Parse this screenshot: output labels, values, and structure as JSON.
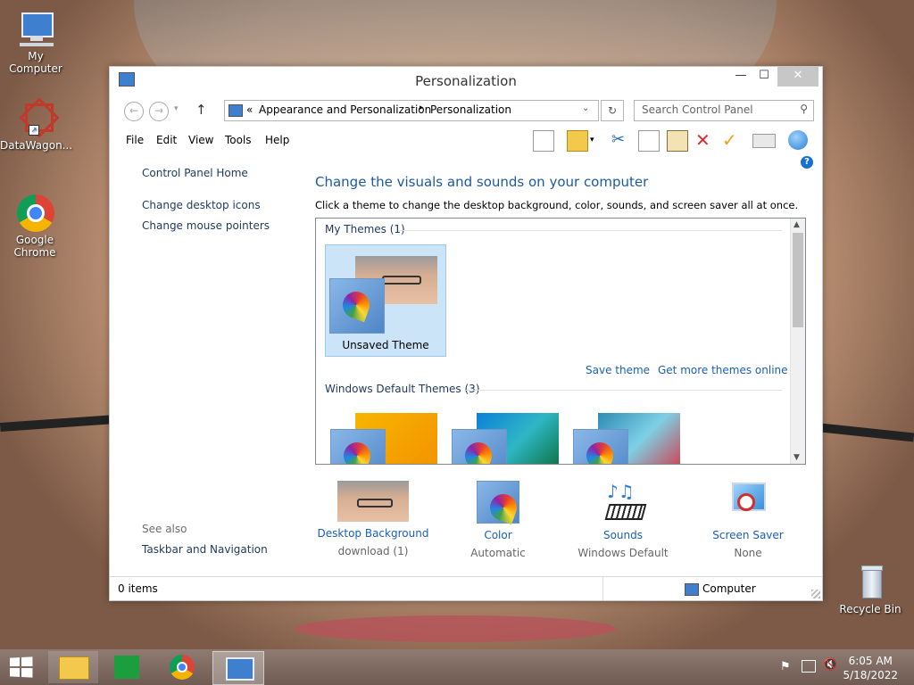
{
  "desktop": {
    "icons": [
      {
        "label": "My Computer"
      },
      {
        "label": "DataWagon..."
      },
      {
        "label": "Google Chrome"
      },
      {
        "label": "Recycle Bin"
      }
    ]
  },
  "window": {
    "title": "Personalization",
    "controls": {
      "minimize": "—",
      "maximize": "☐",
      "close": "✕"
    },
    "address": {
      "chevrons": "«",
      "crumb1": "Appearance and Personalization",
      "separator": "▸",
      "crumb2": "Personalization"
    },
    "search": {
      "placeholder": "Search Control Panel"
    },
    "menu": [
      "File",
      "Edit",
      "View",
      "Tools",
      "Help"
    ],
    "left": {
      "home": "Control Panel Home",
      "links": [
        "Change desktop icons",
        "Change mouse pointers"
      ],
      "see_also": "See also",
      "see_also_link": "Taskbar and Navigation"
    },
    "main": {
      "heading": "Change the visuals and sounds on your computer",
      "subtext": "Click a theme to change the desktop background, color, sounds, and screen saver all at once.",
      "my_themes_header": "My Themes (1)",
      "unsaved_theme": "Unsaved Theme",
      "save_theme": "Save theme",
      "get_more": "Get more themes online",
      "default_themes_header": "Windows Default Themes (3)"
    },
    "bottom": [
      {
        "label": "Desktop Background",
        "sub": "download (1)"
      },
      {
        "label": "Color",
        "sub": "Automatic"
      },
      {
        "label": "Sounds",
        "sub": "Windows Default"
      },
      {
        "label": "Screen Saver",
        "sub": "None"
      }
    ],
    "status": {
      "items": "0 items",
      "location": "Computer"
    }
  },
  "taskbar": {
    "time": "6:05 AM",
    "date": "5/18/2022"
  },
  "colors": {
    "accent": "#1a5fb4",
    "heading": "#1e5aa0"
  }
}
